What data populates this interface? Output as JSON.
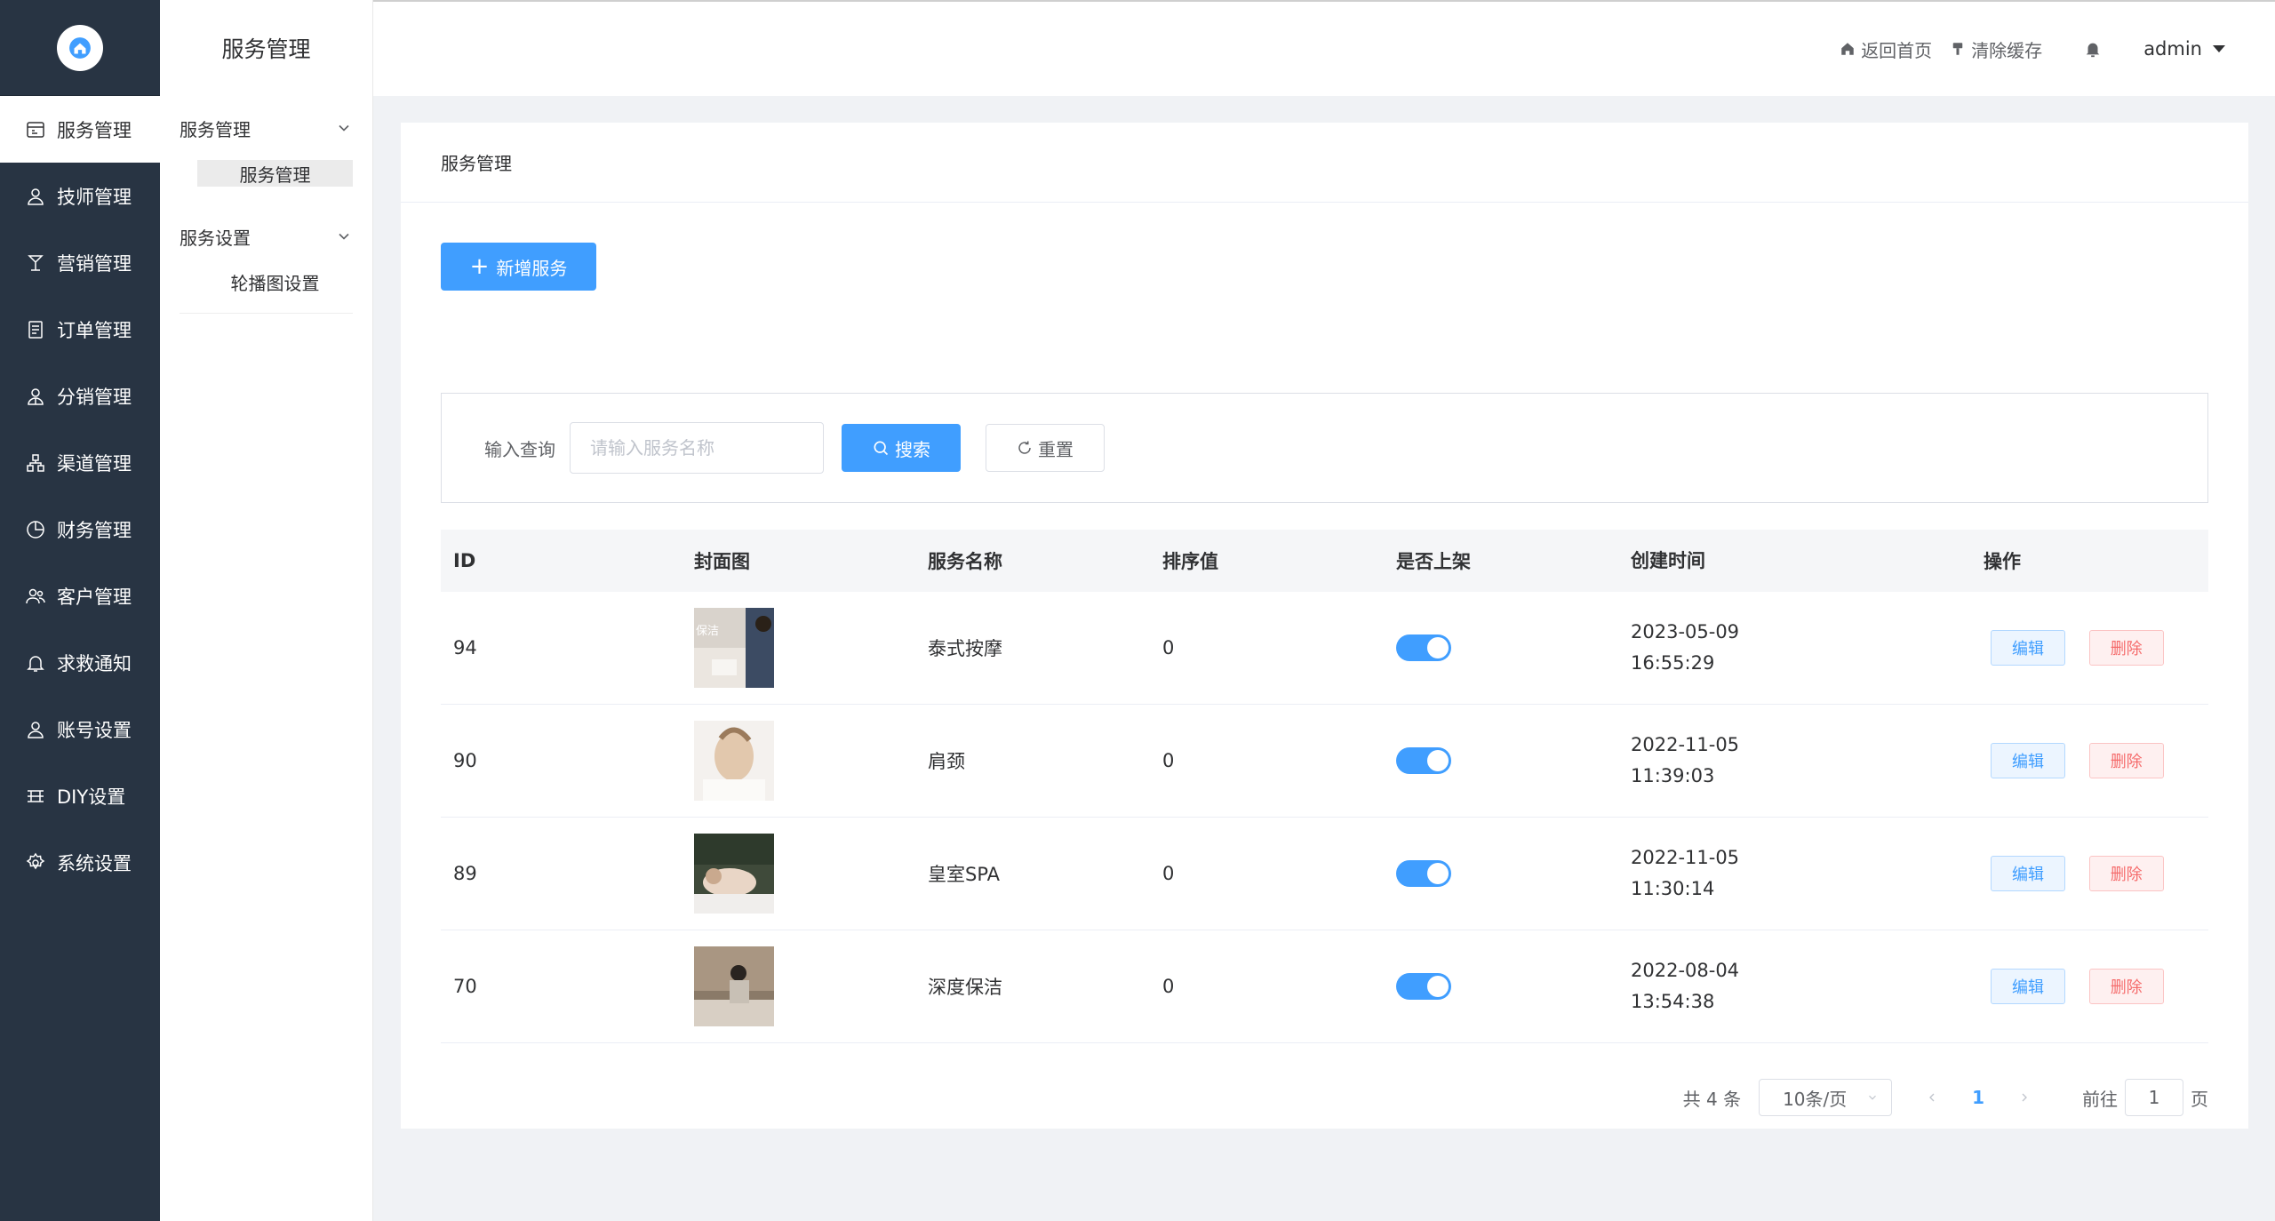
{
  "colors": {
    "nav_bg": "#283443",
    "primary": "#409eff",
    "danger": "#f56c6c"
  },
  "nav": {
    "logo_icon": "home-icon",
    "items": [
      {
        "label": "服务管理",
        "icon": "service-icon",
        "active": true
      },
      {
        "label": "技师管理",
        "icon": "user-icon"
      },
      {
        "label": "营销管理",
        "icon": "marketing-icon"
      },
      {
        "label": "订单管理",
        "icon": "order-icon"
      },
      {
        "label": "分销管理",
        "icon": "distribution-icon"
      },
      {
        "label": "渠道管理",
        "icon": "channel-icon"
      },
      {
        "label": "财务管理",
        "icon": "finance-icon"
      },
      {
        "label": "客户管理",
        "icon": "customer-icon"
      },
      {
        "label": "求救通知",
        "icon": "bell-icon"
      },
      {
        "label": "账号设置",
        "icon": "account-icon"
      },
      {
        "label": "DIY设置",
        "icon": "diy-icon"
      },
      {
        "label": "系统设置",
        "icon": "settings-icon"
      }
    ]
  },
  "submenu": {
    "title": "服务管理",
    "groups": [
      {
        "label": "服务管理",
        "items": [
          "服务管理"
        ],
        "active_item": 0
      },
      {
        "label": "服务设置",
        "items": [
          "轮播图设置"
        ]
      }
    ]
  },
  "header": {
    "home": "返回首页",
    "clear_cache": "清除缓存",
    "user": "admin"
  },
  "main": {
    "breadcrumb": "服务管理",
    "add_button": "新增服务",
    "search": {
      "label": "输入查询",
      "placeholder": "请输入服务名称",
      "search_button": "搜索",
      "reset_button": "重置"
    },
    "table": {
      "columns": [
        "ID",
        "封面图",
        "服务名称",
        "排序值",
        "是否上架",
        "创建时间",
        "操作"
      ],
      "rows": [
        {
          "id": "94",
          "cover_label": "保洁",
          "name": "泰式按摩",
          "sort": "0",
          "on_shelf": true,
          "date": "2023-05-09",
          "time": "16:55:29"
        },
        {
          "id": "90",
          "name": "肩颈",
          "sort": "0",
          "on_shelf": true,
          "date": "2022-11-05",
          "time": "11:39:03"
        },
        {
          "id": "89",
          "name": "皇室SPA",
          "sort": "0",
          "on_shelf": true,
          "date": "2022-11-05",
          "time": "11:30:14"
        },
        {
          "id": "70",
          "name": "深度保洁",
          "sort": "0",
          "on_shelf": true,
          "date": "2022-08-04",
          "time": "13:54:38"
        }
      ],
      "edit_label": "编辑",
      "delete_label": "删除"
    },
    "pagination": {
      "total": "共 4 条",
      "page_size": "10条/页",
      "current": "1",
      "goto_label": "前往",
      "goto_value": "1",
      "page_suffix": "页"
    }
  }
}
